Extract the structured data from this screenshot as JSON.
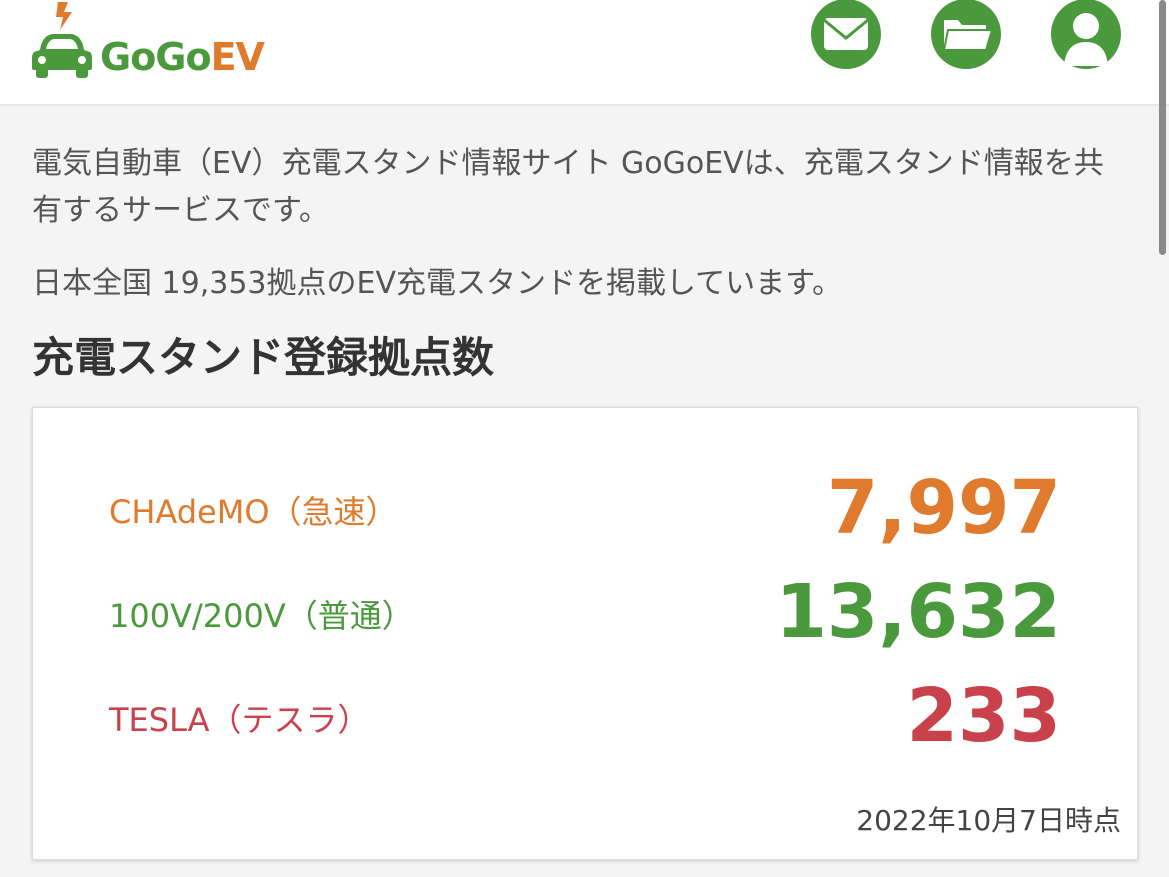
{
  "header": {
    "logo": {
      "text_gogo": "GoGo",
      "text_ev": "EV",
      "icon": "car-lightning-icon"
    },
    "icons": [
      {
        "name": "mail-icon"
      },
      {
        "name": "folder-icon"
      },
      {
        "name": "user-icon"
      }
    ]
  },
  "intro": {
    "description": "電気自動車（EV）充電スタンド情報サイト GoGoEVは、充電スタンド情報を共有するサービスです。",
    "count_line": "日本全国 19,353拠点のEV充電スタンドを掲載しています。"
  },
  "stats": {
    "title": "充電スタンド登録拠点数",
    "items": [
      {
        "label": "CHAdeMO（急速）",
        "value": "7,997",
        "color": "#e07a2c"
      },
      {
        "label": "100V/200V（普通）",
        "value": "13,632",
        "color": "#4a9a3d"
      },
      {
        "label": "TESLA（テスラ）",
        "value": "233",
        "color": "#c8414b"
      }
    ],
    "as_of": "2022年10月7日時点"
  },
  "colors": {
    "brand_green": "#4a9a3d",
    "brand_orange": "#e07a2c",
    "tesla_red": "#c8414b"
  }
}
